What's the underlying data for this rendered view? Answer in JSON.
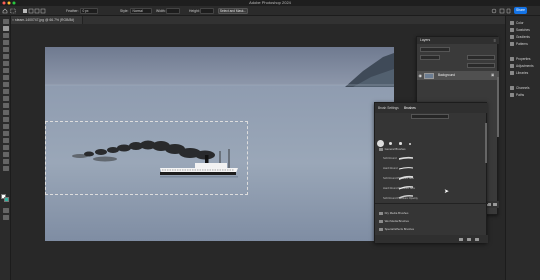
{
  "app": {
    "title": "Adobe Photoshop 2024",
    "share_label": "Share"
  },
  "options_bar": {
    "feather_label": "Feather:",
    "feather_value": "0 px",
    "style_label": "Style:",
    "style_value": "Normal",
    "width_label": "Width:",
    "height_label": "Height:",
    "select_mask_label": "Select and Mask..."
  },
  "document": {
    "tab_title": "steam-1400747.jpg @ 66.7% (RGB/8#)"
  },
  "right_dock": {
    "items": [
      {
        "label": "Color",
        "icon": "color-icon"
      },
      {
        "label": "Swatches",
        "icon": "swatches-icon"
      },
      {
        "label": "Gradients",
        "icon": "gradients-icon"
      },
      {
        "label": "Patterns",
        "icon": "patterns-icon"
      },
      {
        "label": "Properties",
        "icon": "properties-icon"
      },
      {
        "label": "Adjustments",
        "icon": "adjustments-icon"
      },
      {
        "label": "Libraries",
        "icon": "libraries-icon"
      },
      {
        "label": "Channels",
        "icon": "channels-icon"
      },
      {
        "label": "Paths",
        "icon": "paths-icon"
      }
    ]
  },
  "layers": {
    "title": "Layers",
    "layer_name": "Background"
  },
  "brushes": {
    "tabs": [
      "Brush Settings",
      "Brushes"
    ],
    "folders": [
      {
        "label": "General Brushes",
        "subs": [
          "Soft Round",
          "Hard Round",
          "Soft Round Pressure Size",
          "Hard Round Pressure Size",
          "Soft Round Pressure Opacity"
        ]
      },
      {
        "label": "Dry Media Brushes"
      },
      {
        "label": "Wet Media Brushes"
      },
      {
        "label": "Special Effects Brushes"
      }
    ]
  },
  "colors": {
    "accent": "#1473e6",
    "panel": "#353535",
    "sky": "#7e8aa0",
    "water": "#8f9db0"
  }
}
